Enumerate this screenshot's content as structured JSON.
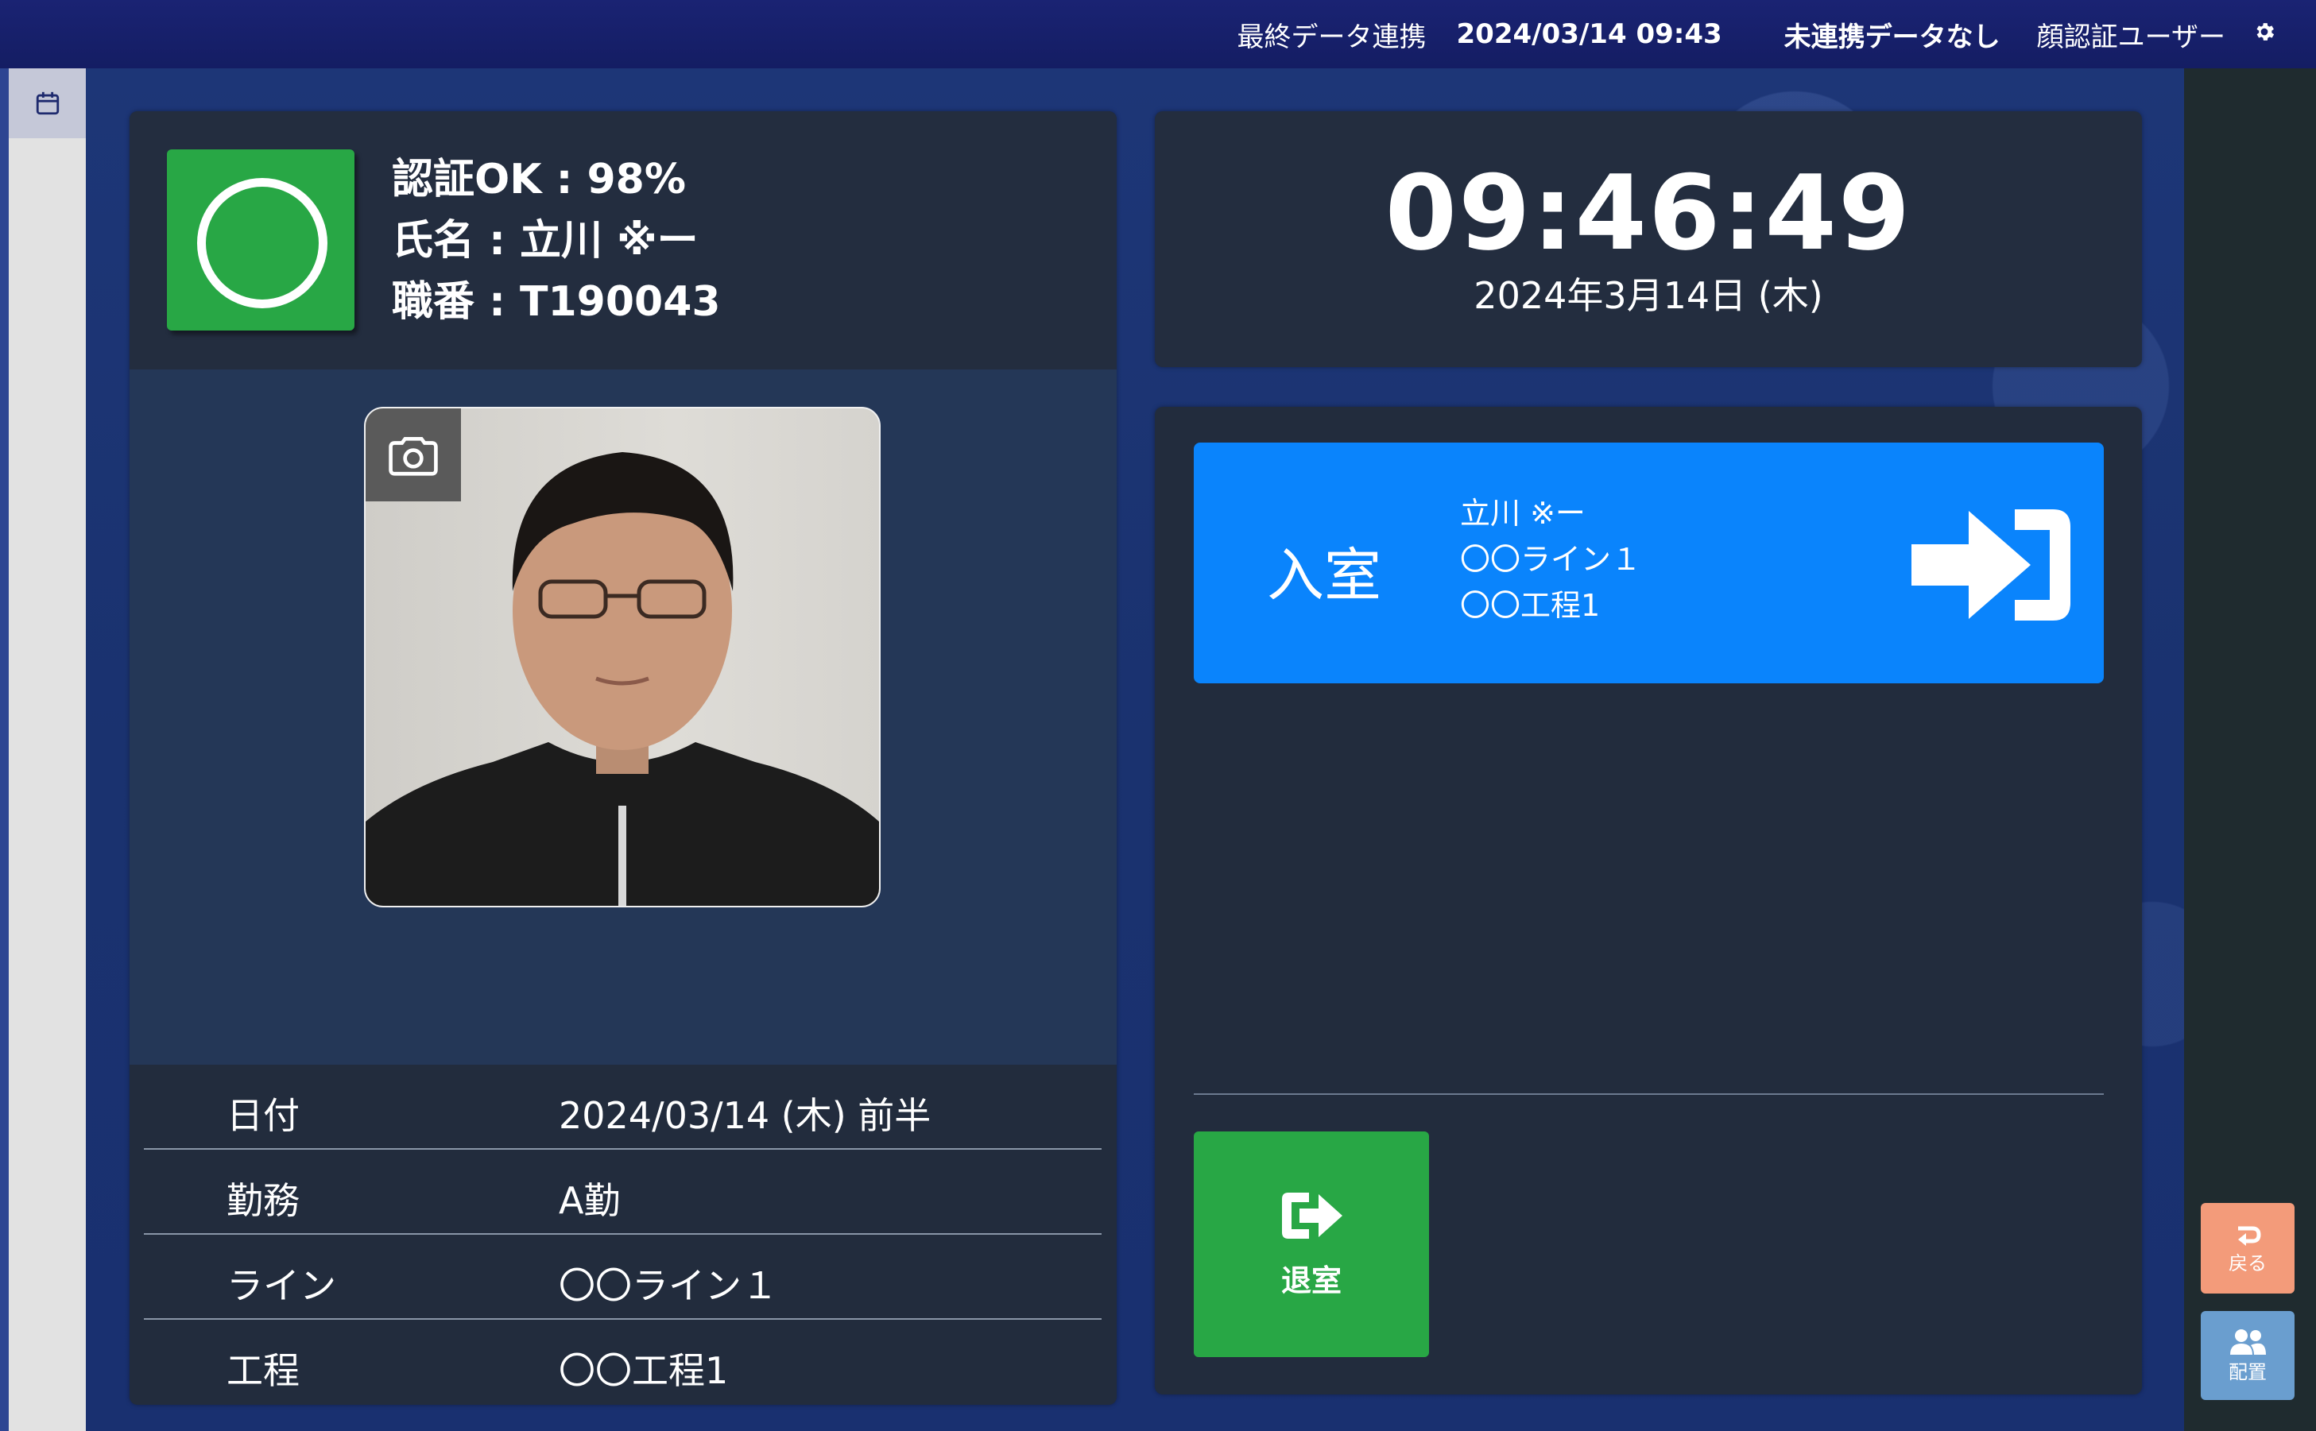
{
  "topbar": {
    "sync_label": "最終データ連携",
    "sync_time": "2024/03/14 09:43",
    "unsynced": "未連携データなし",
    "user": "顔認証ユーザー",
    "settings_icon": "gear-icon"
  },
  "sidebar": {
    "calendar_icon": "calendar-icon"
  },
  "auth": {
    "result": "認証OK : 98%",
    "name": "氏名 : 立川 ※ー",
    "employee_no": "職番 : T190043",
    "status_icon": "circle-ok-icon",
    "status_color": "#28a745"
  },
  "photo": {
    "camera_icon": "camera-icon"
  },
  "info": [
    {
      "label": "日付",
      "value": "2024/03/14 (木) 前半"
    },
    {
      "label": "勤務",
      "value": "A勤"
    },
    {
      "label": "ライン",
      "value": "〇〇ライン１"
    },
    {
      "label": "工程",
      "value": "〇〇工程1"
    }
  ],
  "clock": {
    "time": "09:46:49",
    "date": "2024年3月14日 (木)"
  },
  "entry": {
    "label": "入室",
    "name": "立川 ※ー",
    "line": "〇〇ライン１",
    "process": "〇〇工程1",
    "icon": "sign-in-icon",
    "color": "#0a84fc"
  },
  "exit_button": {
    "label": "退室",
    "icon": "sign-out-icon",
    "color": "#28a745"
  },
  "back_button": {
    "label": "戻る",
    "icon": "return-icon",
    "color": "#f39b7a"
  },
  "assign_button": {
    "label": "配置",
    "icon": "users-icon",
    "color": "#6a9ecf"
  }
}
